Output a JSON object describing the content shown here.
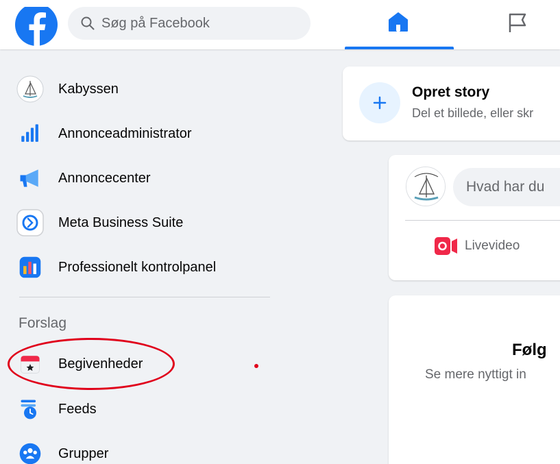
{
  "search": {
    "placeholder": "Søg på Facebook"
  },
  "colors": {
    "brand": "#1877f2",
    "annotation": "#e0001b"
  },
  "sidebar": {
    "items": [
      {
        "label": "Kabyssen",
        "icon": "page-avatar-icon"
      },
      {
        "label": "Annonceadministrator",
        "icon": "bar-chart-icon"
      },
      {
        "label": "Annoncecenter",
        "icon": "megaphone-icon"
      },
      {
        "label": "Meta Business Suite",
        "icon": "meta-business-suite-icon"
      },
      {
        "label": "Professionelt kontrolpanel",
        "icon": "dashboard-icon"
      }
    ],
    "section_heading": "Forslag",
    "suggestions": [
      {
        "label": "Begivenheder",
        "icon": "calendar-star-icon"
      },
      {
        "label": "Feeds",
        "icon": "feeds-clock-icon"
      },
      {
        "label": "Grupper",
        "icon": "groups-icon"
      }
    ]
  },
  "story": {
    "title": "Opret story",
    "subtitle": "Del et billede, eller skr"
  },
  "composer": {
    "placeholder": "Hvad har du",
    "live_label": "Livevideo"
  },
  "follow": {
    "title": "Følg",
    "subtitle": "Se mere nyttigt in"
  }
}
